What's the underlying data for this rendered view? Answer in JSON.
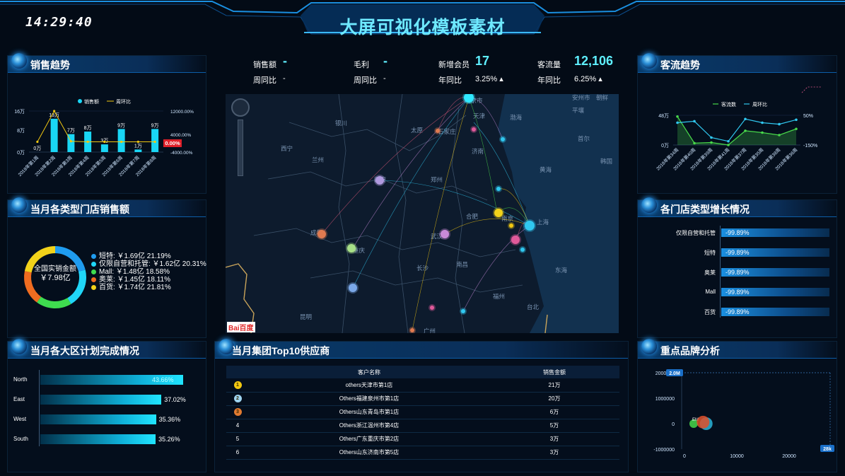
{
  "header": {
    "title": "大屏可视化模板素材",
    "clock": "14:29:40"
  },
  "panels": {
    "sales_trend": {
      "title": "销售趋势"
    },
    "store_type_sales": {
      "title": "当月各类型门店销售额"
    },
    "region_plan": {
      "title": "当月各大区计划完成情况"
    },
    "traffic_trend": {
      "title": "客流趋势"
    },
    "store_growth": {
      "title": "各门店类型增长情况"
    },
    "brand_analysis": {
      "title": "重点品牌分析"
    },
    "top10": {
      "title": "当月集团Top10供应商"
    }
  },
  "kpis": [
    {
      "label": "销售额",
      "value": "-",
      "sub_label": "周同比",
      "sub_value": "-"
    },
    {
      "label": "毛利",
      "value": "-",
      "sub_label": "周同比",
      "sub_value": "-"
    },
    {
      "label": "新增会员",
      "value": "17",
      "sub_label": "年同比",
      "sub_value": "3.25%"
    },
    {
      "label": "客流量",
      "value": "12,106",
      "sub_label": "年同比",
      "sub_value": "6.25%"
    }
  ],
  "colors": {
    "accent": "#5ff0ff",
    "bar": "#19d6f5",
    "line": "#f2c811",
    "green": "#48d84a",
    "red": "#e0202a"
  },
  "chart_data": [
    {
      "type": "bar",
      "title": "销售趋势",
      "legend": [
        "销售额",
        "周环比"
      ],
      "categories": [
        "2018年第1周",
        "2018年第2周",
        "2018年第3周",
        "2018年第4周",
        "2018年第5周",
        "2018年第6周",
        "2018年第7周",
        "2018年第8周"
      ],
      "series": [
        {
          "name": "销售额",
          "values": [
            0,
            13,
            7,
            8,
            3,
            9,
            1,
            9
          ],
          "labels": [
            "0万",
            "13万",
            "7万",
            "8万",
            "3万",
            "9万",
            "1万",
            "9万"
          ]
        },
        {
          "name": "周环比",
          "values": [
            0,
            12000,
            200,
            0,
            0,
            0,
            0,
            0
          ]
        }
      ],
      "y_ticks_left": [
        "16万",
        "8万",
        "0万"
      ],
      "y_ticks_right": [
        "12000.00%",
        "4000.00%",
        "-4000.00%"
      ],
      "badge": "0.00%"
    },
    {
      "type": "pie",
      "title": "当月各类型门店销售额",
      "center_label": "全国实销金额",
      "center_value": "￥7.98亿",
      "slices": [
        {
          "name": "短特",
          "value": 1.69,
          "text": "短特: ￥1.69亿 21.19%",
          "color": "#1f9cf0"
        },
        {
          "name": "仅限自营和托管",
          "value": 1.62,
          "text": "仅限自营和托管: ￥1.62亿 20.31%",
          "color": "#20d6f8"
        },
        {
          "name": "Mall",
          "value": 1.48,
          "text": "Mall: ￥1.48亿 18.58%",
          "color": "#3fdc4f"
        },
        {
          "name": "奥莱",
          "value": 1.45,
          "text": "奥莱: ￥1.45亿 18.11%",
          "color": "#f06c20"
        },
        {
          "name": "百货",
          "value": 1.74,
          "text": "百货: ￥1.74亿 21.81%",
          "color": "#f2d21a"
        }
      ]
    },
    {
      "type": "bar",
      "title": "当月各大区计划完成情况",
      "categories": [
        "North",
        "East",
        "West",
        "South"
      ],
      "values": [
        43.66,
        37.02,
        35.36,
        35.26
      ],
      "labels": [
        "43.66%",
        "37.02%",
        "35.36%",
        "35.26%"
      ]
    },
    {
      "type": "line",
      "title": "客流趋势",
      "legend": [
        "客流数",
        "周环比"
      ],
      "categories": [
        "2018年第34周",
        "2018年第40周",
        "2018年第39周",
        "2018年第41周",
        "2018年第37周",
        "2018年第35周",
        "2018年第38周",
        "2018年第36周"
      ],
      "series": [
        {
          "name": "客流数",
          "values": [
            46,
            3,
            4,
            0,
            23,
            20,
            16,
            26
          ]
        },
        {
          "name": "周环比",
          "values": [
            30,
            32,
            10,
            5,
            35,
            30,
            28,
            34
          ]
        }
      ],
      "y_ticks_left": [
        "48万",
        "0万"
      ],
      "y_ticks_right": [
        "50%",
        "-150%"
      ]
    },
    {
      "type": "bar",
      "title": "各门店类型增长情况",
      "categories": [
        "仅限自营和托管",
        "短特",
        "奥莱",
        "Mall",
        "百货"
      ],
      "values": [
        -99.89,
        -99.89,
        -99.89,
        -99.89,
        -99.89
      ],
      "labels": [
        "-99.89%",
        "-99.89%",
        "-99.89%",
        "-99.89%",
        "-99.89%"
      ]
    },
    {
      "type": "scatter",
      "title": "重点品牌分析",
      "y_ticks": [
        "2000000",
        "1000000",
        "0",
        "-1000000"
      ],
      "x_ticks": [
        "0",
        "10000",
        "20000"
      ],
      "max_badge": "2.0M",
      "x_badge": "28k",
      "points": [
        {
          "x": 400,
          "y": 0,
          "color": "#48d84a",
          "label": "EM"
        },
        {
          "x": 2800,
          "y": 0,
          "color": "#2ab4d8"
        },
        {
          "x": 2200,
          "y": 60000,
          "color": "#e0502a"
        }
      ]
    }
  ],
  "top10": {
    "headers": [
      "",
      "客户名称",
      "销售金额"
    ],
    "rows": [
      {
        "rank": "1",
        "medal": "gold",
        "name": "others天津市第1店",
        "amount": "21万"
      },
      {
        "rank": "2",
        "medal": "silver",
        "name": "Others福建泉州市第1店",
        "amount": "20万"
      },
      {
        "rank": "3",
        "medal": "bronze",
        "name": "Others山东青岛市第1店",
        "amount": "6万"
      },
      {
        "rank": "4",
        "medal": "",
        "name": "Others浙江温州市第4店",
        "amount": "5万"
      },
      {
        "rank": "5",
        "medal": "",
        "name": "Others广东重庆市第2店",
        "amount": "3万"
      },
      {
        "rank": "6",
        "medal": "",
        "name": "Others山东济南市第5店",
        "amount": "3万"
      }
    ]
  },
  "map": {
    "labels": [
      "北京市",
      "天津",
      "石家庄",
      "太原",
      "济南",
      "郑州",
      "合肥",
      "南京",
      "上海",
      "武汉",
      "长沙",
      "南昌",
      "福州",
      "台北",
      "广州",
      "昆明",
      "成都",
      "重庆",
      "西安",
      "兰州",
      "西宁",
      "银川",
      "渤海",
      "黄海",
      "东海",
      "首尔",
      "平壤",
      "朝鲜",
      "韩国",
      "安州市"
    ],
    "logo": "Bai百度"
  }
}
